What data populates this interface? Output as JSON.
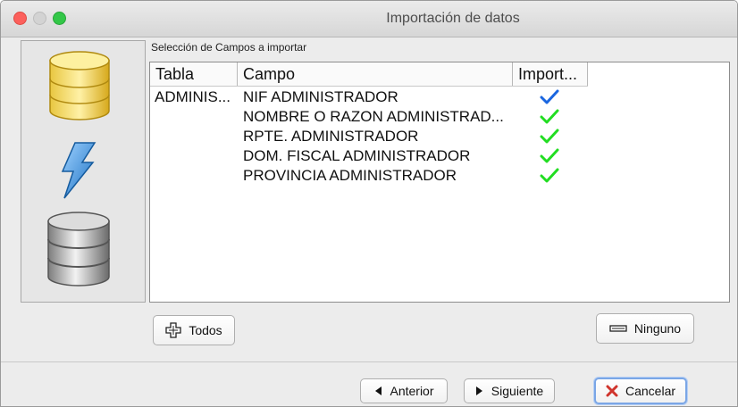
{
  "window": {
    "title": "Importación de datos"
  },
  "section": {
    "label": "Selección de Campos a importar"
  },
  "table": {
    "columns": [
      "Tabla",
      "Campo",
      "Import..."
    ],
    "rows": [
      {
        "tabla": "ADMINIS...",
        "campo": "NIF ADMINISTRADOR",
        "import": true,
        "check_color": "#1a66e0"
      },
      {
        "tabla": "",
        "campo": "NOMBRE O RAZON ADMINISTRAD...",
        "import": true,
        "check_color": "#22dd22"
      },
      {
        "tabla": "",
        "campo": "RPTE. ADMINISTRADOR",
        "import": true,
        "check_color": "#22dd22"
      },
      {
        "tabla": "",
        "campo": "DOM. FISCAL ADMINISTRADOR",
        "import": true,
        "check_color": "#22dd22"
      },
      {
        "tabla": "",
        "campo": "PROVINCIA ADMINISTRADOR",
        "import": true,
        "check_color": "#22dd22"
      }
    ]
  },
  "buttons": {
    "todos": "Todos",
    "ninguno": "Ninguno",
    "anterior": "Anterior",
    "siguiente": "Siguiente",
    "cancelar": "Cancelar"
  },
  "icons": {
    "side": [
      "database-gold-icon",
      "lightning-icon",
      "database-gray-icon"
    ],
    "todos": "add-icon",
    "ninguno": "remove-icon",
    "anterior": "arrow-left-icon",
    "siguiente": "arrow-right-icon",
    "cancelar": "cancel-x-icon"
  }
}
